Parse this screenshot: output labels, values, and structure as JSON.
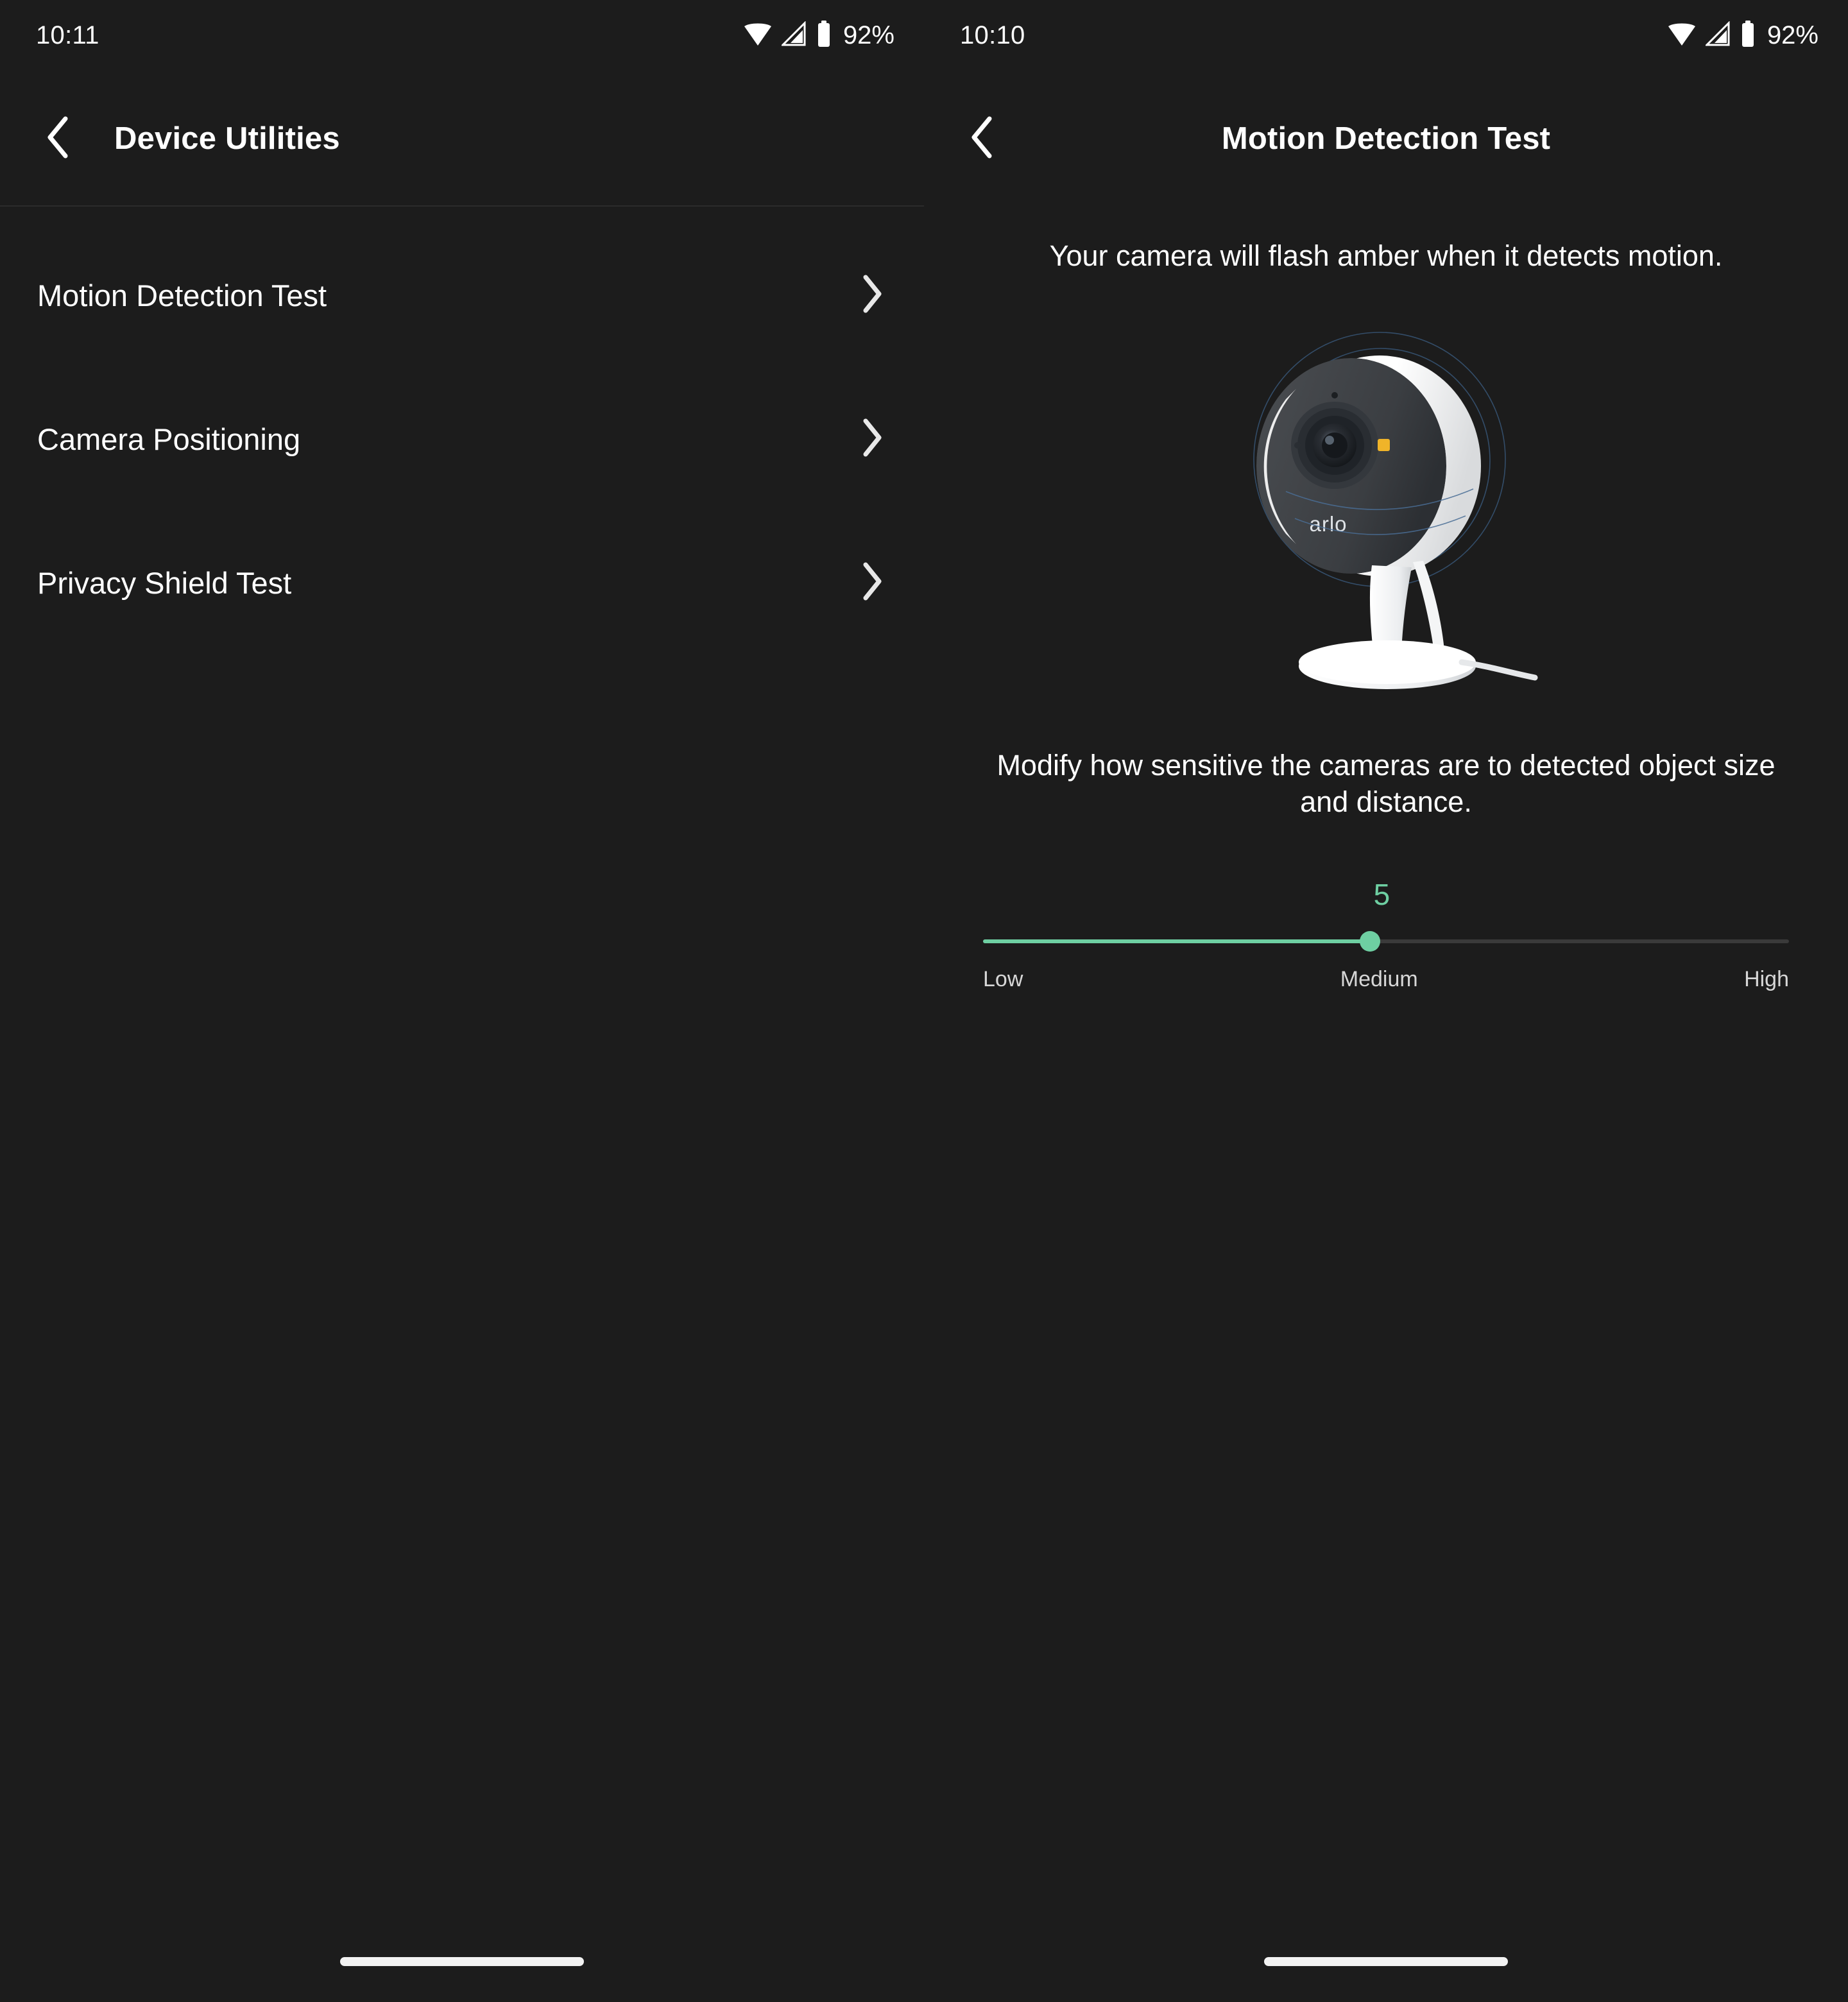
{
  "left": {
    "status": {
      "time": "10:11",
      "battery": "92%",
      "icons": [
        "wifi-icon",
        "cellular-signal-icon",
        "battery-icon"
      ]
    },
    "header": {
      "back_icon": "chevron-left-icon",
      "title": "Device Utilities"
    },
    "list": [
      {
        "label": "Motion Detection Test",
        "chevron": "chevron-right-icon"
      },
      {
        "label": "Camera Positioning",
        "chevron": "chevron-right-icon"
      },
      {
        "label": "Privacy Shield Test",
        "chevron": "chevron-right-icon"
      }
    ]
  },
  "right": {
    "status": {
      "time": "10:10",
      "battery": "92%",
      "icons": [
        "wifi-icon",
        "cellular-signal-icon",
        "battery-icon"
      ]
    },
    "header": {
      "back_icon": "chevron-left-icon",
      "title": "Motion Detection Test"
    },
    "description": "Your camera will flash amber when it detects motion.",
    "camera_image": {
      "name": "arlo-indoor-camera-illustration",
      "brand_text": "arlo",
      "led_color": "#f0b429"
    },
    "sub_description": "Modify how sensitive the cameras are to detected object size and distance.",
    "slider": {
      "value": "5",
      "min_label": "Low",
      "mid_label": "Medium",
      "max_label": "High",
      "fill_percent": 48,
      "accent_color": "#6ecfa2",
      "track_color": "#3a3a3a"
    }
  }
}
